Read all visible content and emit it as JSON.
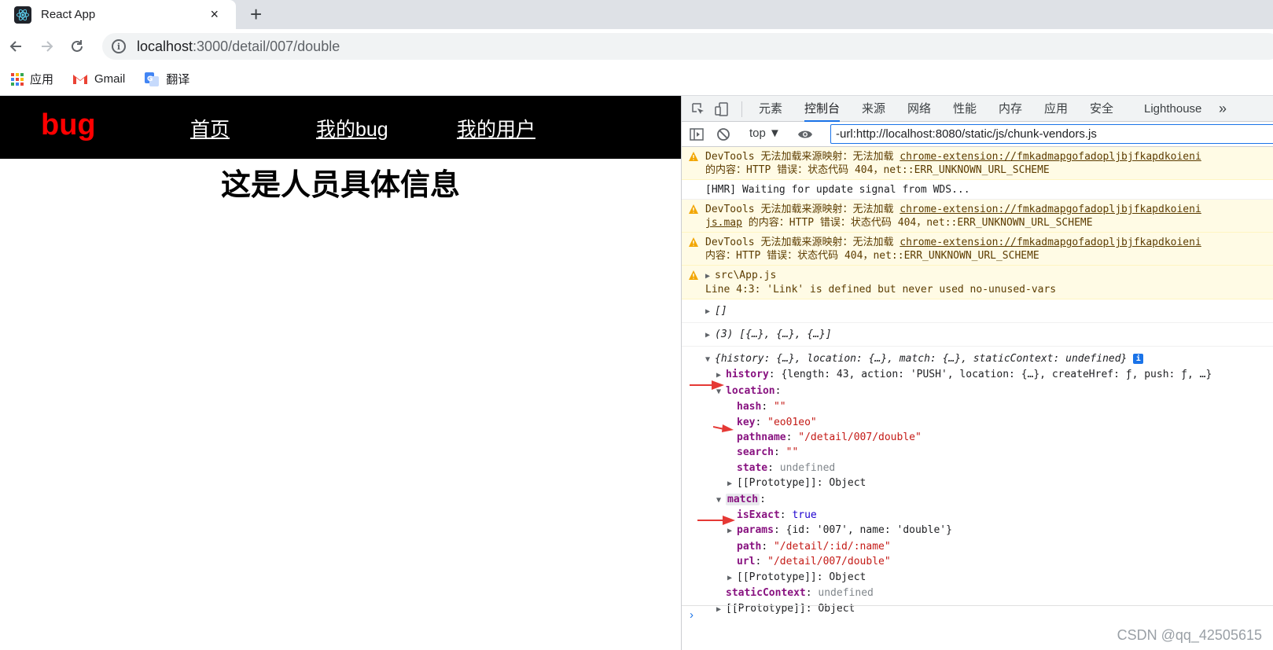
{
  "browser": {
    "tab_title": "React App",
    "tab_close": "×",
    "new_tab": "+",
    "url_host": "localhost",
    "url_path": ":3000/detail/007/double"
  },
  "bookmarks": [
    {
      "label": "应用",
      "icon": "apps-grid-icon"
    },
    {
      "label": "Gmail",
      "icon": "gmail-icon"
    },
    {
      "label": "翻译",
      "icon": "translate-icon"
    }
  ],
  "page": {
    "logo": "bug",
    "nav": [
      "首页",
      "我的bug",
      "我的用户"
    ],
    "heading": "这是人员具体信息"
  },
  "devtools": {
    "tabs": [
      "元素",
      "控制台",
      "来源",
      "网络",
      "性能",
      "内存",
      "应用",
      "安全",
      "Lighthouse"
    ],
    "more": "»",
    "context": "top ▼",
    "filter_value": "-url:http://localhost:8080/static/js/chunk-vendors.js",
    "warn1_line1_text": "DevTools 无法加载来源映射：无法加载 ",
    "warn1_line1_link": "chrome-extension://fmkadmapgofadopljbjfkapdkoieni",
    "warn1_line2": "的内容：HTTP 错误：状态代码 404，net::ERR_UNKNOWN_URL_SCHEME",
    "hmr": "[HMR] Waiting for update signal from WDS...",
    "warn2_line1_text": "DevTools 无法加载来源映射：无法加载 ",
    "warn2_line1_link": "chrome-extension://fmkadmapgofadopljbjfkapdkoieni",
    "warn2_line2_link": "js.map",
    "warn2_line2_text": " 的内容：HTTP 错误：状态代码 404，net::ERR_UNKNOWN_URL_SCHEME",
    "warn3_line1_text": "DevTools 无法加载来源映射：无法加载 ",
    "warn3_line1_link": "chrome-extension://fmkadmapgofadopljbjfkapdkoieni",
    "warn3_line2": "内容：HTTP 错误：状态代码 404，net::ERR_UNKNOWN_URL_SCHEME",
    "warn4_line1": "src\\App.js",
    "warn4_line2": " Line 4:3:  'Link' is defined but never used  no-unused-vars",
    "log_empty": "[]",
    "log_array": "(3) [{…}, {…}, {…}]",
    "props_summary": "{history: {…}, location: {…}, match: {…}, staticContext: undefined}",
    "history_key": "history",
    "history_val": "{length: 43, action: 'PUSH', location: {…}, createHref: ƒ, push: ƒ, …}",
    "location_key": "location",
    "hash_key": "hash",
    "hash_val": "\"\"",
    "key_key": "key",
    "key_val": "\"eo01eo\"",
    "pathname_key": "pathname",
    "pathname_val": "\"/detail/007/double\"",
    "search_key": "search",
    "search_val": "\"\"",
    "state_key": "state",
    "state_val": "undefined",
    "proto_key": "[[Prototype]]",
    "proto_val": "Object",
    "match_key": "match",
    "isexact_key": "isExact",
    "isexact_val": "true",
    "params_key": "params",
    "params_val": "{id: '007', name: 'double'}",
    "path_key": "path",
    "path_val": "\"/detail/:id/:name\"",
    "url_key": "url",
    "url_val": "\"/detail/007/double\"",
    "staticctx_key": "staticContext",
    "staticctx_val": "undefined",
    "prompt": "›"
  },
  "watermark": "CSDN @qq_42505615",
  "colors": {
    "logo": "#ff0000",
    "nav_bg": "#000000",
    "accent": "#1a73e8",
    "warn_bg": "#fffbe5",
    "annotation_arrow": "#e53935"
  }
}
